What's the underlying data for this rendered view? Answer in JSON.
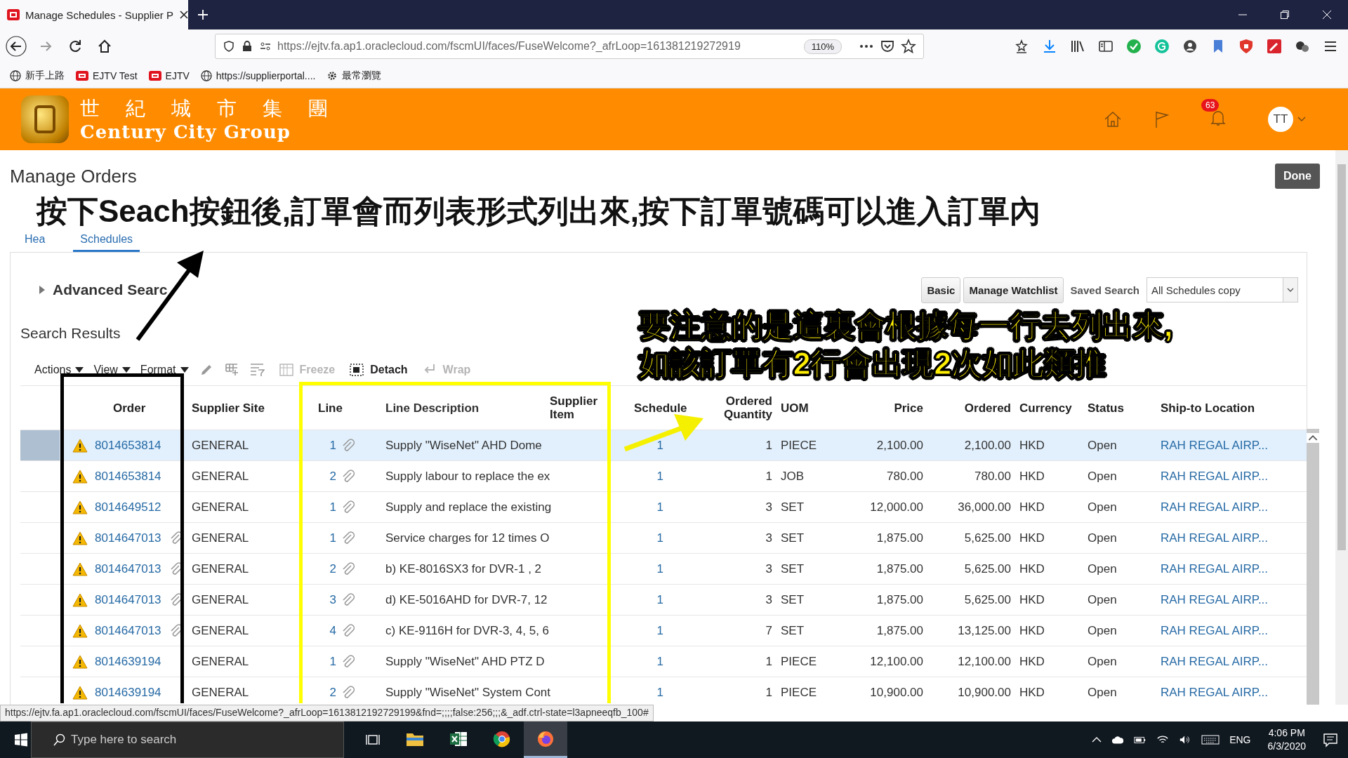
{
  "browser": {
    "tab_title": "Manage Schedules - Supplier P",
    "url": "https://ejtv.fa.ap1.oraclecloud.com/fscmUI/faces/FuseWelcome?_afrLoop=161381219272919",
    "zoom": "110%",
    "bookmarks": [
      {
        "label": "新手上路",
        "kind": "globe"
      },
      {
        "label": "EJTV Test",
        "kind": "oracle"
      },
      {
        "label": "EJTV",
        "kind": "oracle"
      },
      {
        "label": "https://supplierportal....",
        "kind": "globe"
      },
      {
        "label": "最常瀏覽",
        "kind": "gear"
      }
    ]
  },
  "header": {
    "logo_chinese": "世 紀 城 市 集 團",
    "logo_english": "Century City Group",
    "notifications": "63",
    "avatar": "TT"
  },
  "page": {
    "title": "Manage Orders",
    "done": "Done"
  },
  "annotations": {
    "top_note": "按下Seach按鈕後,訂單會而列表形式列出來,按下訂單號碼可以進入訂單內",
    "side_note": [
      "要注意的是這裏會根據每一行去列出來,",
      "如該訂單有2行會出現2次如此類推"
    ]
  },
  "tabs": [
    {
      "label": "Hea",
      "selected": false
    },
    {
      "label": "Schedules",
      "selected": true
    }
  ],
  "search": {
    "advanced": "Advanced Searc",
    "basic": "Basic",
    "watchlist": "Manage Watchlist",
    "saved_label": "Saved Search",
    "saved_value": "All Schedules copy"
  },
  "results_title": "Search Results",
  "toolbar": {
    "menus": [
      "Actions",
      "View",
      "Format"
    ],
    "buttons": [
      {
        "label": "Freeze",
        "disabled": true
      },
      {
        "label": "Detach",
        "disabled": false
      },
      {
        "label": "Wrap",
        "disabled": true
      }
    ]
  },
  "columns": [
    "Order",
    "Supplier Site",
    "Line",
    "Line Description",
    "Supplier Item",
    "Schedule",
    "Ordered Quantity",
    "UOM",
    "Price",
    "Ordered",
    "Currency",
    "Status",
    "Ship-to Location"
  ],
  "rows": [
    {
      "selected": true,
      "order": "8014653814",
      "order_attachment": false,
      "site": "GENERAL",
      "line": "1",
      "description": "Supply \"WiseNet\" AHD Dome",
      "schedule": "1",
      "quantity": "1",
      "uom": "PIECE",
      "price": "2,100.00",
      "ordered": "2,100.00",
      "currency": "HKD",
      "status": "Open",
      "ship_to": "RAH REGAL AIRP..."
    },
    {
      "selected": false,
      "order": "8014653814",
      "order_attachment": false,
      "site": "GENERAL",
      "line": "2",
      "description": "Supply labour to replace the ex",
      "schedule": "1",
      "quantity": "1",
      "uom": "JOB",
      "price": "780.00",
      "ordered": "780.00",
      "currency": "HKD",
      "status": "Open",
      "ship_to": "RAH REGAL AIRP..."
    },
    {
      "selected": false,
      "order": "8014649512",
      "order_attachment": false,
      "site": "GENERAL",
      "line": "1",
      "description": "Supply and replace the existing",
      "schedule": "1",
      "quantity": "3",
      "uom": "SET",
      "price": "12,000.00",
      "ordered": "36,000.00",
      "currency": "HKD",
      "status": "Open",
      "ship_to": "RAH REGAL AIRP..."
    },
    {
      "selected": false,
      "order": "8014647013",
      "order_attachment": true,
      "site": "GENERAL",
      "line": "1",
      "description": "Service charges for 12 times O",
      "schedule": "1",
      "quantity": "3",
      "uom": "SET",
      "price": "1,875.00",
      "ordered": "5,625.00",
      "currency": "HKD",
      "status": "Open",
      "ship_to": "RAH REGAL AIRP..."
    },
    {
      "selected": false,
      "order": "8014647013",
      "order_attachment": true,
      "site": "GENERAL",
      "line": "2",
      "description": "b) KE-8016SX3 for DVR-1 , 2",
      "schedule": "1",
      "quantity": "3",
      "uom": "SET",
      "price": "1,875.00",
      "ordered": "5,625.00",
      "currency": "HKD",
      "status": "Open",
      "ship_to": "RAH REGAL AIRP..."
    },
    {
      "selected": false,
      "order": "8014647013",
      "order_attachment": true,
      "site": "GENERAL",
      "line": "3",
      "description": "d) KE-5016AHD for DVR-7, 12",
      "schedule": "1",
      "quantity": "3",
      "uom": "SET",
      "price": "1,875.00",
      "ordered": "5,625.00",
      "currency": "HKD",
      "status": "Open",
      "ship_to": "RAH REGAL AIRP..."
    },
    {
      "selected": false,
      "order": "8014647013",
      "order_attachment": true,
      "site": "GENERAL",
      "line": "4",
      "description": "c) KE-9116H for DVR-3, 4, 5, 6",
      "schedule": "1",
      "quantity": "7",
      "uom": "SET",
      "price": "1,875.00",
      "ordered": "13,125.00",
      "currency": "HKD",
      "status": "Open",
      "ship_to": "RAH REGAL AIRP..."
    },
    {
      "selected": false,
      "order": "8014639194",
      "order_attachment": false,
      "site": "GENERAL",
      "line": "1",
      "description": "Supply \"WiseNet\" AHD PTZ D",
      "schedule": "1",
      "quantity": "1",
      "uom": "PIECE",
      "price": "12,100.00",
      "ordered": "12,100.00",
      "currency": "HKD",
      "status": "Open",
      "ship_to": "RAH REGAL AIRP..."
    },
    {
      "selected": false,
      "order": "8014639194",
      "order_attachment": false,
      "site": "GENERAL",
      "line": "2",
      "description": "Supply \"WiseNet\" System Cont",
      "schedule": "1",
      "quantity": "1",
      "uom": "PIECE",
      "price": "10,900.00",
      "ordered": "10,900.00",
      "currency": "HKD",
      "status": "Open",
      "ship_to": "RAH REGAL AIRP..."
    }
  ],
  "status_url": "https://ejtv.fa.ap1.oraclecloud.com/fscmUI/faces/FuseWelcome?_afrLoop=1613812192729199&fnd=;;;;false:256;;;&_adf.ctrl-state=l3apneeqfb_100#",
  "taskbar": {
    "search_placeholder": "Type here to search",
    "language": "ENG",
    "time": "4:06 PM",
    "date": "6/3/2020"
  }
}
